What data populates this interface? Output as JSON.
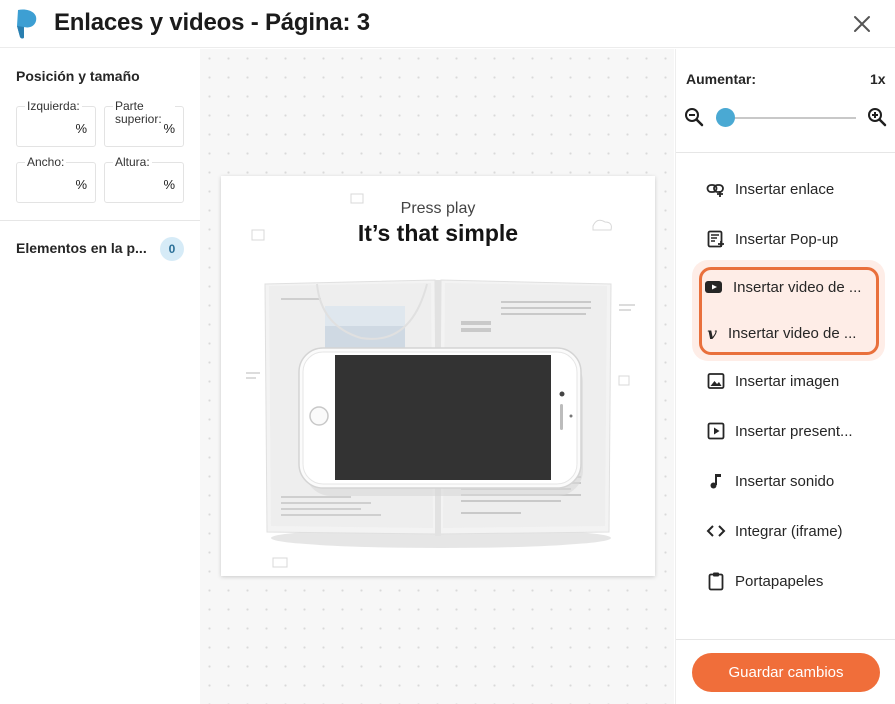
{
  "header": {
    "title": "Enlaces y videos - Página: 3"
  },
  "left_panel": {
    "position_size_title": "Posición y tamaño",
    "fields": {
      "left": {
        "label": "Izquierda:",
        "unit": "%"
      },
      "top": {
        "label": "Parte superior:",
        "unit": "%"
      },
      "width": {
        "label": "Ancho:",
        "unit": "%"
      },
      "height": {
        "label": "Altura:",
        "unit": "%"
      }
    },
    "elements_title": "Elementos en la p...",
    "elements_count": "0"
  },
  "page_preview": {
    "line1": "Press play",
    "line2": "It’s that simple"
  },
  "right_panel": {
    "zoom_label": "Aumentar:",
    "zoom_value": "1x",
    "zoom_level_fraction": 0.0,
    "menu": [
      {
        "label": "Insertar enlace",
        "icon": "link-icon"
      },
      {
        "label": "Insertar Pop-up",
        "icon": "popup-icon"
      },
      {
        "label": "Insertar video de ...",
        "icon": "youtube-icon"
      },
      {
        "label": "Insertar video de ...",
        "icon": "vimeo-icon"
      },
      {
        "label": "Insertar imagen",
        "icon": "image-icon"
      },
      {
        "label": "Insertar present...",
        "icon": "presentation-icon"
      },
      {
        "label": "Insertar sonido",
        "icon": "music-note-icon"
      },
      {
        "label": "Integrar (iframe)",
        "icon": "code-icon"
      },
      {
        "label": "Portapapeles",
        "icon": "clipboard-icon"
      }
    ],
    "save_label": "Guardar cambios"
  },
  "colors": {
    "accent": "#f06e3a",
    "highlight_border": "#e9703c",
    "slider_thumb": "#4aa9d3",
    "logo": "#3d9fd3"
  }
}
